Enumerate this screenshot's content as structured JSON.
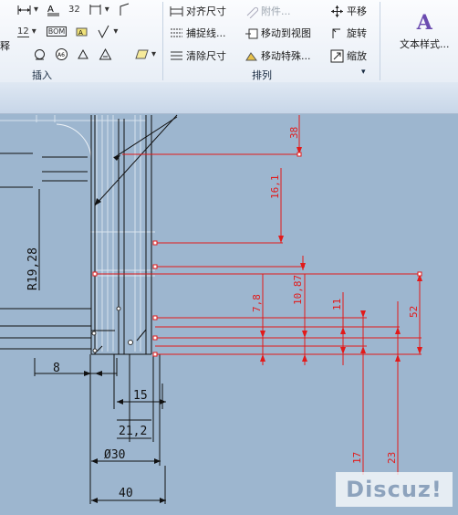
{
  "ribbon": {
    "left_partial_label": "释",
    "insert_group_label": "插入",
    "arrange_group_label": "排列",
    "arrange_group_launcher": "▾",
    "tools": {
      "align_dims": "对齐尺寸",
      "attach": "附件...",
      "pan": "平移",
      "snap_line": "捕捉线...",
      "move_to_view": "移动到视图",
      "rotate": "旋转",
      "clear_dims": "清除尺寸",
      "move_special": "移动特殊...",
      "zoom": "缩放",
      "text_style": "文本样式..."
    },
    "insert_icons": {
      "r1": [
        "dimension-horizontal-icon",
        "text-format-icon",
        "exponent-icon",
        "ordinate-icon",
        "leader-icon"
      ],
      "r1_text": [
        "",
        "",
        "32",
        "",
        ""
      ],
      "r2": [
        "tolerance-stack-icon",
        "balloon-icon",
        "datum-icon",
        "surface-finish-icon"
      ],
      "r2_text": [
        "12",
        "BOM",
        "",
        ""
      ],
      "r3": [
        "geometric-tolerance-icon",
        "target-icon",
        "weld-icon",
        "hatch-icon"
      ]
    }
  },
  "drawing": {
    "black_dims": {
      "r19_28": "R19,28",
      "d8": "8",
      "d15": "15",
      "d21_2": "21,2",
      "d30": "Ø30",
      "d40": "40"
    },
    "red_dims": {
      "r38": "38",
      "r16_1": "16,1",
      "r10_87": "10,87",
      "r7_8": "7,8",
      "r11": "11",
      "r52": "52",
      "r17": "17",
      "r23": "23"
    }
  },
  "watermark": "Discuz!",
  "colors": {
    "canvas_bg": "#9db6cf",
    "dimension_red": "#e21a1a",
    "geometry_black": "#111111",
    "ribbon_bg": "#f2f5fa"
  }
}
